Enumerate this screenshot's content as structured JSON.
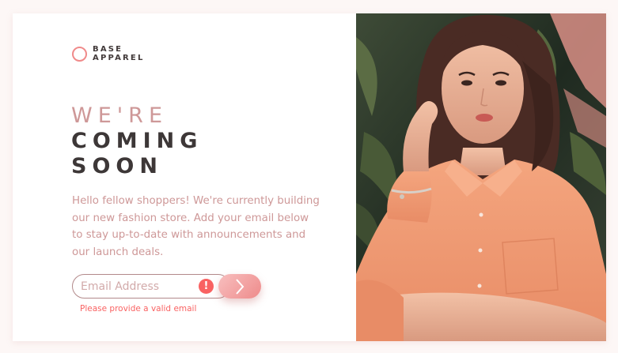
{
  "brand": {
    "line1": "BASE",
    "line2": "APPAREL"
  },
  "headline": {
    "thin": "WE'RE",
    "bold_line1": "COMING",
    "bold_line2": "SOON"
  },
  "description": "Hello fellow shoppers! We're currently building our new fashion store. Add your email below to stay up-to-date with announcements and our launch deals.",
  "form": {
    "email_placeholder": "Email Address",
    "email_value": "",
    "error_icon": "!",
    "error_message": "Please provide a valid email",
    "submit_icon": "chevron-right-icon"
  },
  "hero_image": {
    "description_icon": "photo-woman-in-peach-shirt"
  },
  "colors": {
    "accent": "#f08a8a",
    "desaturated_red": "#ce9898",
    "dark_grayish_red": "#423a3a",
    "error": "#f96262",
    "background": "#fdf7f6"
  }
}
